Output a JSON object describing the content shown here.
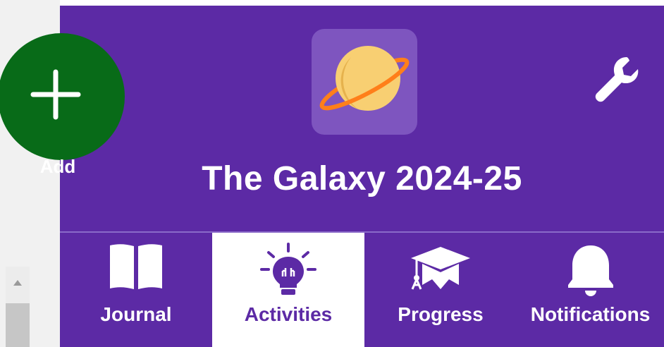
{
  "colors": {
    "header_bg": "#5c2aa5",
    "add_button_bg": "#086b18",
    "active_tab_bg": "#ffffff",
    "text_light": "#ffffff",
    "text_active": "#5c2aa5"
  },
  "add_button": {
    "label": "Add",
    "icon": "plus-icon"
  },
  "header": {
    "title": "The Galaxy 2024-25",
    "logo_icon": "planet-icon",
    "settings_icon": "wrench-icon"
  },
  "nav": {
    "tabs": [
      {
        "label": "Journal",
        "icon": "book-icon",
        "active": false
      },
      {
        "label": "Activities",
        "icon": "lightbulb-icon",
        "active": true
      },
      {
        "label": "Progress",
        "icon": "graduation-cap-icon",
        "active": false
      },
      {
        "label": "Notifications",
        "icon": "bell-icon",
        "active": false
      }
    ]
  }
}
